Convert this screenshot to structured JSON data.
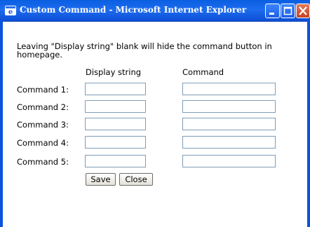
{
  "window": {
    "title": "Custom Command - Microsoft Internet Explorer"
  },
  "hint": "Leaving \"Display string\" blank will hide the command button in homepage.",
  "columns": {
    "display": "Display string",
    "command": "Command"
  },
  "rows": [
    {
      "label": "Command 1:",
      "display": "",
      "command": ""
    },
    {
      "label": "Command 2:",
      "display": "",
      "command": ""
    },
    {
      "label": "Command 3:",
      "display": "",
      "command": ""
    },
    {
      "label": "Command 4:",
      "display": "",
      "command": ""
    },
    {
      "label": "Command 5:",
      "display": "",
      "command": ""
    }
  ],
  "buttons": {
    "save": "Save",
    "close": "Close"
  },
  "icons": {
    "window": "ie-logo-icon",
    "minimize": "minimize-icon",
    "maximize": "maximize-icon",
    "close": "close-icon"
  },
  "colors": {
    "titlebar": "#0a5fe0",
    "close_button": "#c7401f",
    "field_border": "#7f9db9"
  }
}
